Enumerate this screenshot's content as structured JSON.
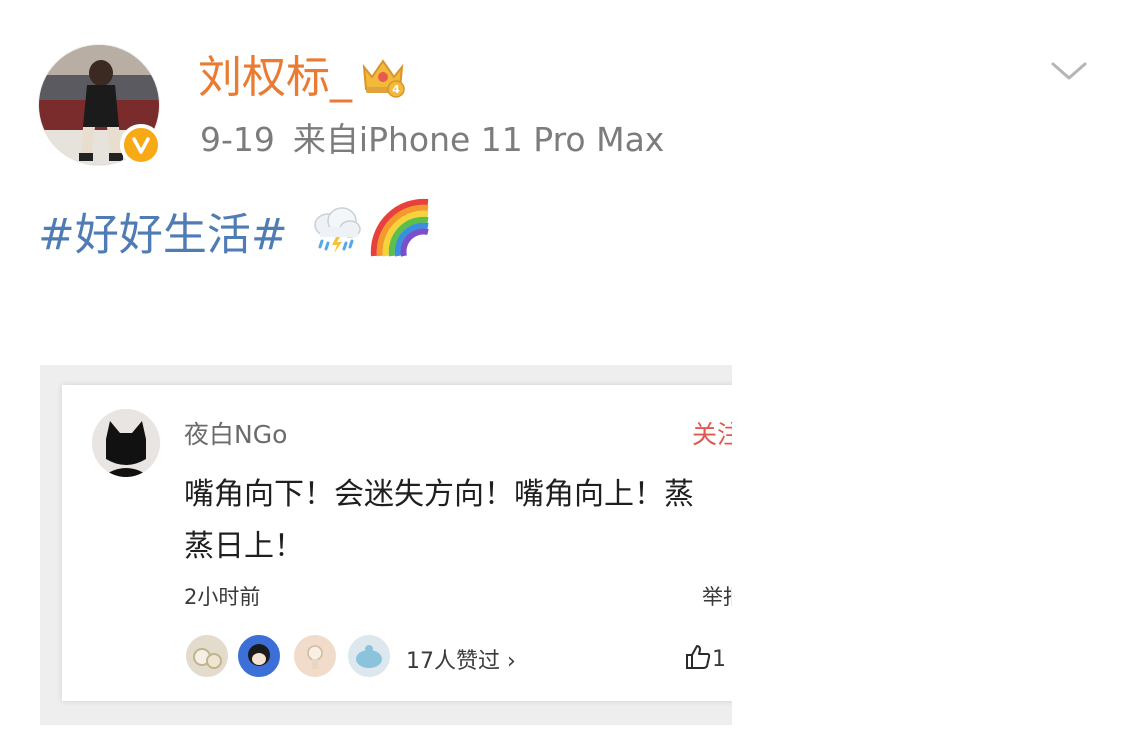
{
  "post": {
    "author": "刘权标_",
    "date": "9-19",
    "source": "来自iPhone 11 Pro Max",
    "hashtag": "#好好生活#",
    "emojis": [
      "cloud-rain-lightning-icon",
      "rainbow-icon"
    ],
    "badge": "verified-badge",
    "crown": "crown-icon",
    "crown_level": "4"
  },
  "embedded_comment": {
    "user": "夜白NGo",
    "follow_label": "关注",
    "text_line1": "嘴角向下！会迷失方向！嘴角向上！蒸",
    "text_line2": "蒸日上！",
    "time": "2小时前",
    "report_label": "举报",
    "likes_summary": "17人赞过",
    "likes_count": "1"
  },
  "colors": {
    "name": "#ea7b32",
    "hashtag": "#4f7cb4",
    "meta": "#7c7c7c",
    "follow": "#e0594e",
    "badge": "#f7a916"
  }
}
